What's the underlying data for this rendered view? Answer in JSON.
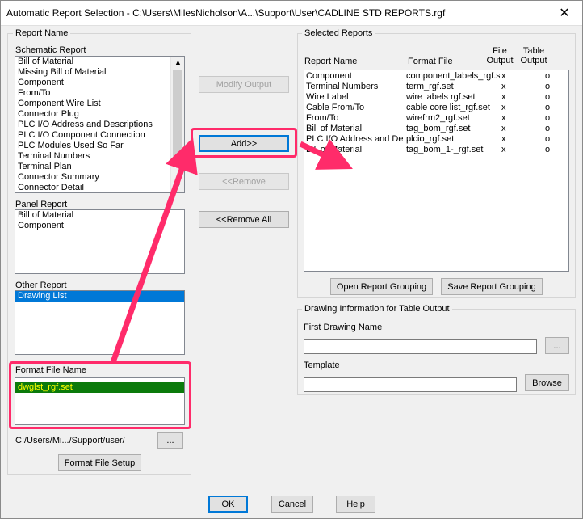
{
  "window": {
    "title": "Automatic Report Selection - C:\\Users\\MilesNicholson\\A...\\Support\\User\\CADLINE STD REPORTS.rgf",
    "close_glyph": "✕"
  },
  "left": {
    "report_name_group": "Report Name",
    "schematic": {
      "label": "Schematic Report",
      "items": [
        "Bill of Material",
        "Missing Bill of Material",
        "Component",
        "From/To",
        "Component Wire List",
        "Connector Plug",
        "PLC I/O Address and Descriptions",
        "PLC I/O Component Connection",
        "PLC Modules Used So Far",
        "Terminal Numbers",
        "Terminal Plan",
        "Connector Summary",
        "Connector Detail"
      ]
    },
    "panel": {
      "label": "Panel Report",
      "items": [
        "Bill of Material",
        "Component"
      ]
    },
    "other": {
      "label": "Other Report",
      "items": [
        "Drawing List"
      ],
      "selected": "Drawing List"
    },
    "format_file": {
      "label": "Format File Name",
      "items": [
        "dwglst_rgf.set"
      ]
    },
    "path": "C:/Users/Mi.../Support/user/",
    "browse_label": "...",
    "setup_label": "Format File Setup"
  },
  "middle": {
    "modify_label": "Modify Output",
    "add_label": "Add>>",
    "remove_label": "<<Remove",
    "remove_all_label": "<<Remove All"
  },
  "right": {
    "group_label": "Selected Reports",
    "headers": {
      "report_name": "Report Name",
      "format_file": "Format File",
      "file_output": [
        "File",
        "Output"
      ],
      "table_output": [
        "Table",
        "Output"
      ]
    },
    "rows": [
      {
        "name": "Component",
        "file": "component_labels_rgf.s",
        "fo": "x",
        "to": "o"
      },
      {
        "name": "Terminal Numbers",
        "file": "term_rgf.set",
        "fo": "x",
        "to": "o"
      },
      {
        "name": "Wire Label",
        "file": "wire labels rgf.set",
        "fo": "x",
        "to": "o"
      },
      {
        "name": "Cable From/To",
        "file": "cable core list_rgf.set",
        "fo": "x",
        "to": "o"
      },
      {
        "name": "From/To",
        "file": "wirefrm2_rgf.set",
        "fo": "x",
        "to": "o"
      },
      {
        "name": "Bill of Material",
        "file": "tag_bom_rgf.set",
        "fo": "x",
        "to": "o"
      },
      {
        "name": "PLC I/O Address and De",
        "file": "plcio_rgf.set",
        "fo": "x",
        "to": "o"
      },
      {
        "name": "Bill of Material",
        "file": "tag_bom_1-_rgf.set",
        "fo": "x",
        "to": "o"
      }
    ],
    "open_grouping_label": "Open Report Grouping",
    "save_grouping_label": "Save Report Grouping",
    "drawing_info_label": "Drawing Information for Table Output",
    "first_drawing_label": "First Drawing Name",
    "first_drawing_value": "",
    "first_browse_label": "...",
    "template_label": "Template",
    "template_value": "",
    "template_browse_label": "Browse"
  },
  "footer": {
    "ok_label": "OK",
    "cancel_label": "Cancel",
    "help_label": "Help"
  },
  "colors": {
    "annotation": "#ff2b6a",
    "selection_blue": "#0078d7",
    "selection_green": "#0b7a0b",
    "highlight_yellow": "#ffff00"
  }
}
